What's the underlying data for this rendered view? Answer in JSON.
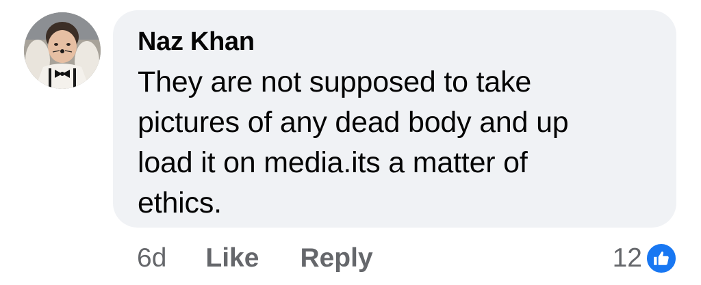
{
  "comment": {
    "author": "Naz Khan",
    "text": "They are not supposed to take pictures of any dead body and up load it on media.its a matter of ethics."
  },
  "actions": {
    "timestamp": "6d",
    "like_label": "Like",
    "reply_label": "Reply"
  },
  "reactions": {
    "count": "12",
    "icon": "thumbs-up-icon",
    "color": "#1877f2"
  },
  "colors": {
    "bubble": "#f0f2f5",
    "text": "#050505",
    "muted": "#65676b"
  }
}
